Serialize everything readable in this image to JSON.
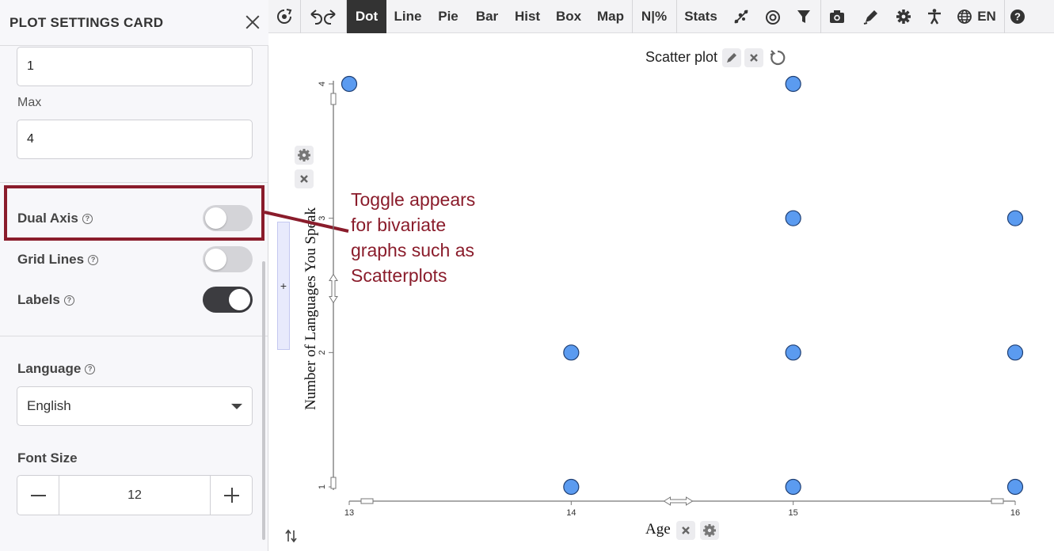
{
  "sidebar": {
    "title": "PLOT SETTINGS CARD",
    "min_value": "1",
    "max_label": "Max",
    "max_value": "4",
    "dual_axis": {
      "label": "Dual Axis",
      "on": false
    },
    "grid_lines": {
      "label": "Grid Lines",
      "on": false
    },
    "labels": {
      "label": "Labels",
      "on": true
    },
    "language": {
      "label": "Language",
      "value": "English"
    },
    "font_size": {
      "label": "Font Size",
      "value": "12"
    },
    "help_glyph": "?",
    "plus": "+"
  },
  "toolbar": {
    "tabs": [
      "Dot",
      "Line",
      "Pie",
      "Bar",
      "Hist",
      "Box",
      "Map",
      "N|%",
      "Stats"
    ],
    "active_tab": "Dot",
    "language": "EN",
    "icons": [
      "recenter-icon",
      "undo-icon",
      "redo-icon",
      "trend-icon",
      "target-icon",
      "filter-icon",
      "camera-icon",
      "pen-icon",
      "gear-icon",
      "accessibility-icon",
      "globe-icon",
      "help-icon"
    ]
  },
  "plot": {
    "title": "Scatter plot",
    "annotation": [
      "Toggle appears",
      "for bivariate",
      "graphs such as",
      "Scatterplots"
    ],
    "accent": "#8a1c2b"
  },
  "chart_data": {
    "type": "scatter",
    "title": "Scatter plot",
    "xlabel": "Age",
    "ylabel": "Number of Languages You Speak",
    "xlim": [
      13,
      16
    ],
    "ylim": [
      1,
      4
    ],
    "xticks": [
      "13",
      "14",
      "15",
      "16"
    ],
    "yticks": [
      "1",
      "2",
      "3",
      "4"
    ],
    "points": [
      {
        "x": 13,
        "y": 4
      },
      {
        "x": 15,
        "y": 4
      },
      {
        "x": 15,
        "y": 3
      },
      {
        "x": 16,
        "y": 3
      },
      {
        "x": 14,
        "y": 2
      },
      {
        "x": 15,
        "y": 2
      },
      {
        "x": 16,
        "y": 2
      },
      {
        "x": 14,
        "y": 1
      },
      {
        "x": 15,
        "y": 1
      },
      {
        "x": 16,
        "y": 1
      }
    ],
    "point_color": "#5b9bf0",
    "grid": false
  }
}
